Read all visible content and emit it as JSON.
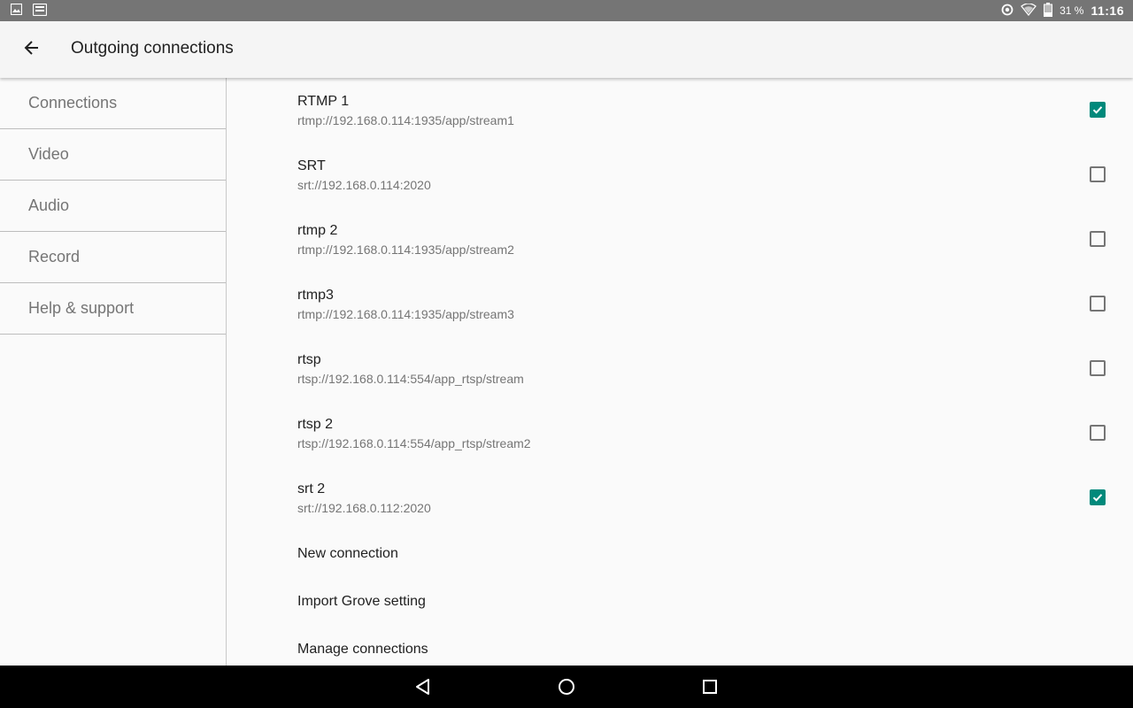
{
  "status_bar": {
    "battery": "31 %",
    "time": "11:16",
    "icons": [
      "image-icon",
      "cast-icon",
      "data-saver-icon",
      "wifi-icon",
      "battery-icon"
    ]
  },
  "app_bar": {
    "title": "Outgoing connections",
    "back_icon": "arrow-back-icon"
  },
  "sidebar": {
    "items": [
      {
        "label": "Connections"
      },
      {
        "label": "Video"
      },
      {
        "label": "Audio"
      },
      {
        "label": "Record"
      },
      {
        "label": "Help & support"
      }
    ]
  },
  "connections": [
    {
      "name": "RTMP 1",
      "url": "rtmp://192.168.0.114:1935/app/stream1",
      "checked": true
    },
    {
      "name": "SRT",
      "url": "srt://192.168.0.114:2020",
      "checked": false
    },
    {
      "name": "rtmp 2",
      "url": "rtmp://192.168.0.114:1935/app/stream2",
      "checked": false
    },
    {
      "name": "rtmp3",
      "url": "rtmp://192.168.0.114:1935/app/stream3",
      "checked": false
    },
    {
      "name": "rtsp",
      "url": "rtsp://192.168.0.114:554/app_rtsp/stream",
      "checked": false
    },
    {
      "name": "rtsp 2",
      "url": "rtsp://192.168.0.114:554/app_rtsp/stream2",
      "checked": false
    },
    {
      "name": "srt 2",
      "url": "srt://192.168.0.112:2020",
      "checked": true
    }
  ],
  "actions": {
    "new_connection": "New connection",
    "import_grove": "Import Grove setting",
    "manage_connections": "Manage connections"
  },
  "nav_bar": {
    "icons": [
      "back-triangle-icon",
      "home-circle-icon",
      "recents-square-icon"
    ]
  },
  "colors": {
    "accent": "#00897b",
    "status_bar": "#757575",
    "nav_bar": "#000000"
  }
}
